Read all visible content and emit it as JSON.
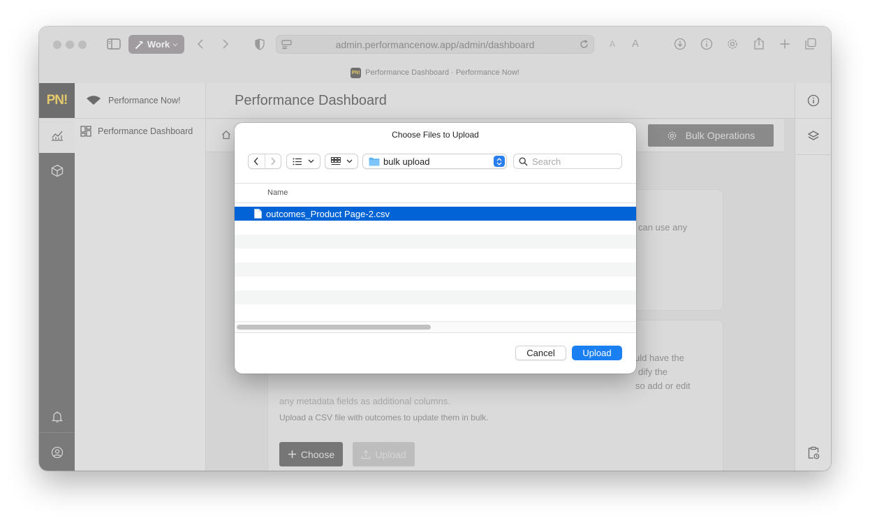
{
  "browser": {
    "profile_label": "Work",
    "url": "admin.performancenow.app/admin/dashboard",
    "tab_title": "Performance Dashboard · Performance Now!",
    "favicon_text": "PN!",
    "text_size_small": "A",
    "text_size_large": "A"
  },
  "app": {
    "logo_text": "PN!",
    "brand_name": "Performance Now!",
    "sidebar": {
      "items": [
        {
          "label": "Performance Dashboard"
        }
      ]
    },
    "page_title": "Performance Dashboard",
    "bulk_button_label": "Bulk Operations",
    "card1": {
      "text_fragment": "can use any"
    },
    "card2": {
      "text_fragments": [
        "uld have the",
        "dify the",
        "so add or edit"
      ],
      "partial_line": "any metadata fields as additional columns.",
      "instruction": "Upload a CSV file with outcomes to update them in bulk.",
      "choose_label": "Choose",
      "upload_label": "Upload"
    }
  },
  "dialog": {
    "title": "Choose Files to Upload",
    "location": "bulk upload",
    "search_placeholder": "Search",
    "column_name": "Name",
    "files": [
      {
        "name": "outcomes_Product Page-2.csv",
        "selected": true
      }
    ],
    "cancel_label": "Cancel",
    "upload_label": "Upload"
  },
  "colors": {
    "accent": "#1a7ff0",
    "selection": "#0064d6",
    "logo_gold": "#e3c96b"
  }
}
